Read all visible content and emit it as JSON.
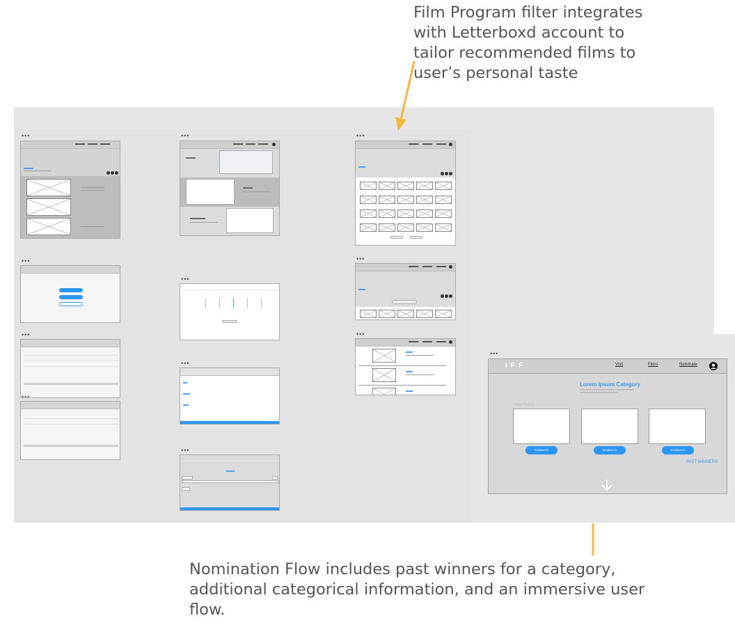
{
  "captions": {
    "top": "Film Program filter integrates\nwith Letterboxd account to\ntailor recommended films to\nuser’s personal taste",
    "bottom": "Nomination Flow includes past winners for a category,\nadditional categorical information, and an immersive user\nflow."
  },
  "window_dots": "•••",
  "nomination_mockup": {
    "logo": "IFF",
    "nav": [
      "Visit",
      "Films",
      "Nominate"
    ],
    "category_title": "Lorem Ipsum Category",
    "your_films_label": "Your Films",
    "nominate_buttons": [
      "NOMINATE",
      "NOMINATE",
      "NOMINATE"
    ],
    "past_winners_link": "PAST WINNERS"
  },
  "colors": {
    "annotation_arrow": "#f0b93a",
    "accent_blue": "#2b96f3",
    "canvas_gray": "#e6e6e6"
  }
}
